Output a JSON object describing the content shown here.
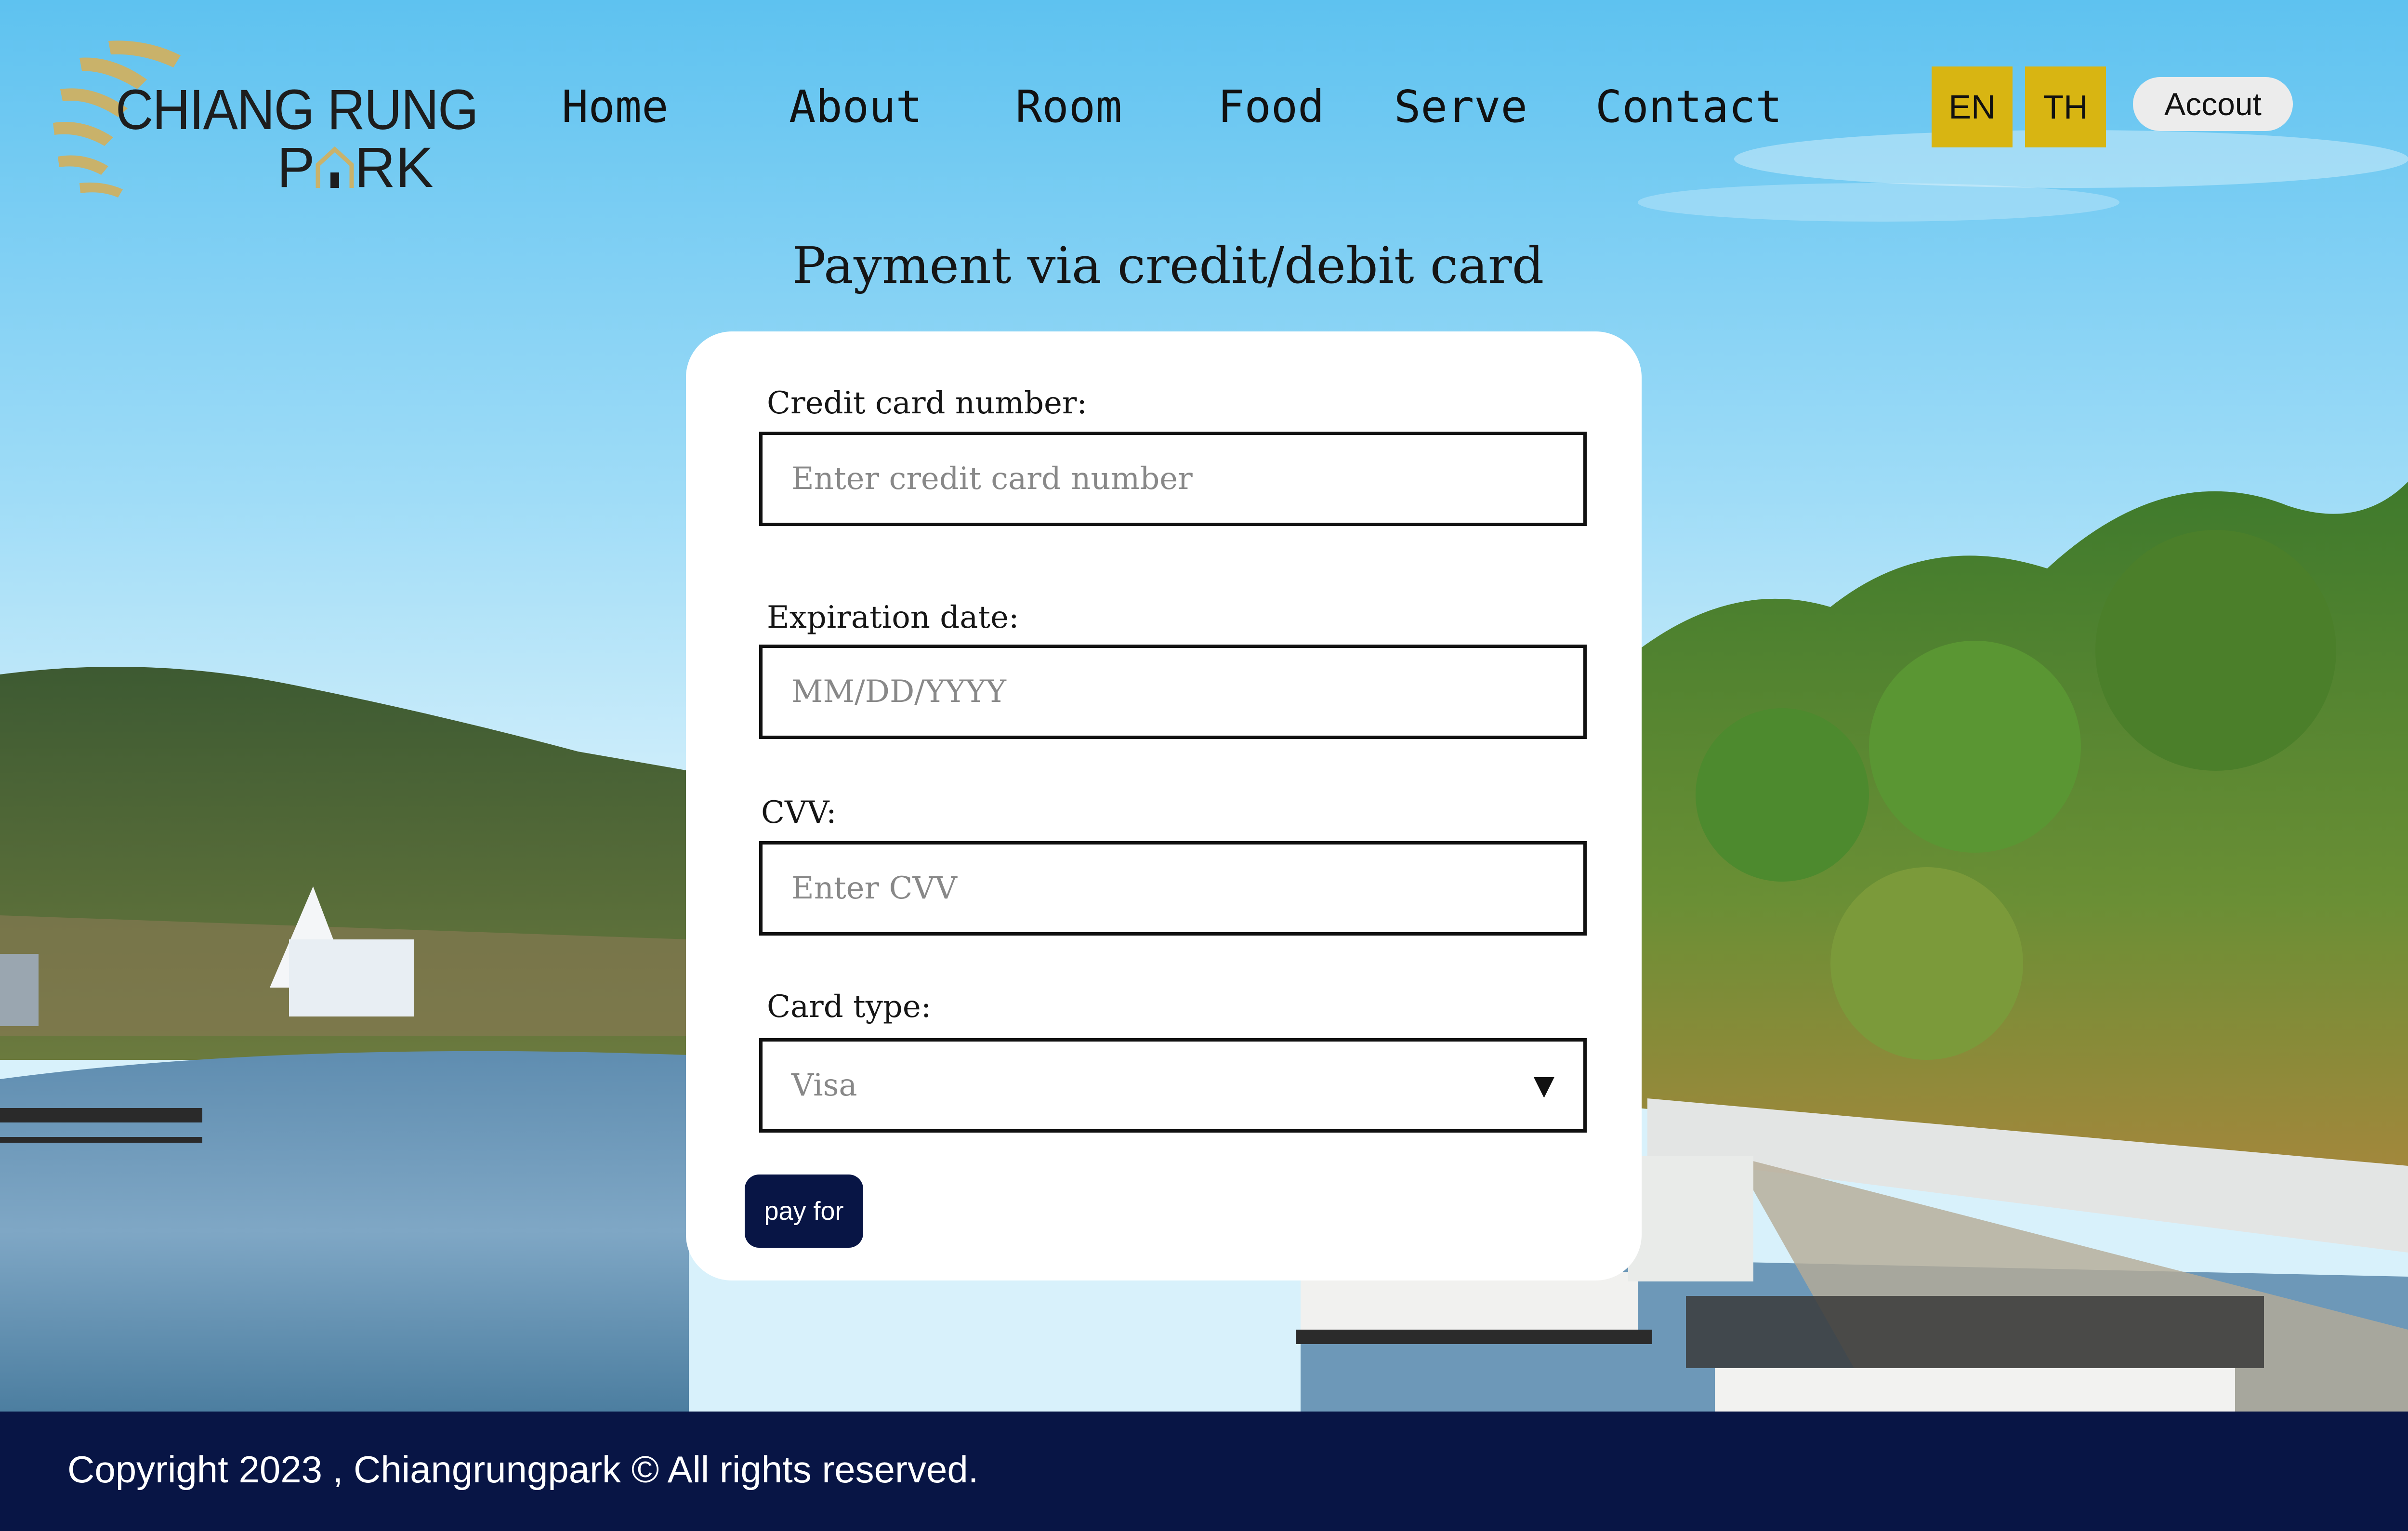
{
  "brand": {
    "line1": "CHIANG RUNG",
    "line2_left": "P",
    "line2_right": "RK"
  },
  "nav": {
    "items": [
      {
        "label": "Home"
      },
      {
        "label": "About"
      },
      {
        "label": "Room"
      },
      {
        "label": "Food"
      },
      {
        "label": "Serve"
      },
      {
        "label": "Contact"
      }
    ],
    "lang_en": "EN",
    "lang_th": "TH",
    "account": "Accout"
  },
  "form": {
    "title": "Payment via credit/debit card",
    "card_number": {
      "label": "Credit card number:",
      "placeholder": "Enter credit card number"
    },
    "expiration": {
      "label": "Expiration date:",
      "placeholder": "MM/DD/YYYY"
    },
    "cvv": {
      "label": "CVV:",
      "placeholder": "Enter CVV"
    },
    "card_type": {
      "label": "Card type:",
      "selected": "Visa"
    },
    "submit": "pay for"
  },
  "footer": {
    "copyright": "Copyright 2023 , Chiangrungpark © All rights reserved."
  },
  "colors": {
    "accent_gold": "#d8b512",
    "navy": "#081545",
    "logo_gold": "#c9b26a"
  }
}
